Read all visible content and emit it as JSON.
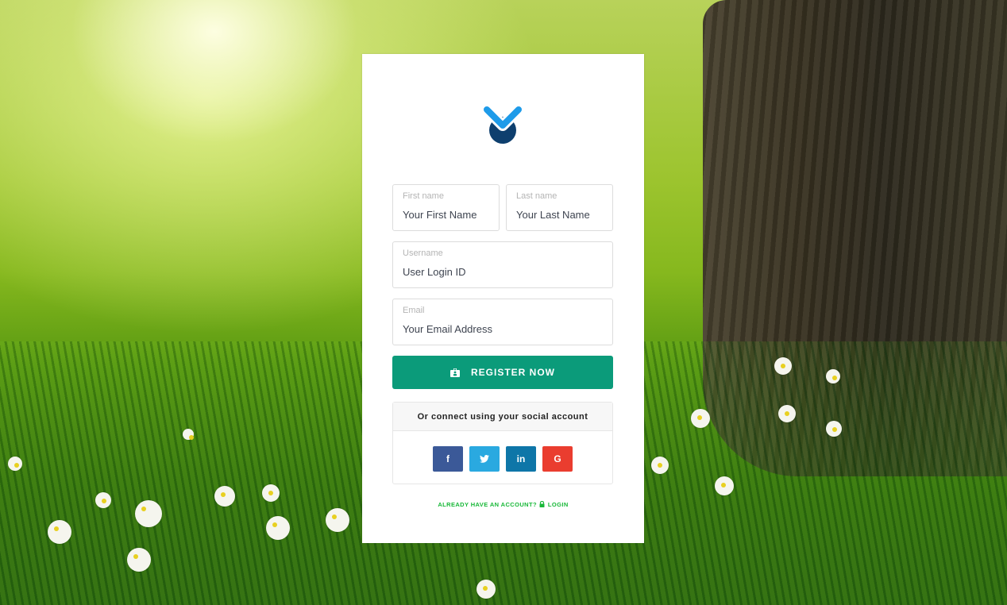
{
  "background": {
    "description": "sunlit meadow with tree trunk and white flowers"
  },
  "logo": {
    "name": "brand-logo",
    "colors": {
      "chevron": "#1e9be9",
      "circle": "#0e3f6e"
    }
  },
  "form": {
    "first_name": {
      "label": "First name",
      "placeholder": "Your First Name",
      "value": ""
    },
    "last_name": {
      "label": "Last name",
      "placeholder": "Your Last Name",
      "value": ""
    },
    "username": {
      "label": "Username",
      "placeholder": "User Login ID",
      "value": ""
    },
    "email": {
      "label": "Email",
      "placeholder": "Your Email Address",
      "value": ""
    },
    "register_button": {
      "label": "REGISTER NOW",
      "icon": "id-badge-icon",
      "color": "#0b9b7a"
    }
  },
  "social": {
    "heading": "Or connect using your social account",
    "buttons": [
      {
        "name": "facebook",
        "glyph": "f",
        "color": "#3b5998"
      },
      {
        "name": "twitter",
        "glyph": "t",
        "color": "#2aa9e0"
      },
      {
        "name": "linkedin",
        "glyph": "in",
        "color": "#0e76a8"
      },
      {
        "name": "google",
        "glyph": "G",
        "color": "#ea3d2f"
      }
    ]
  },
  "footer": {
    "prompt": "ALREADY HAVE AN ACCOUNT?",
    "login_label": "LOGIN",
    "color": "#18b838"
  }
}
